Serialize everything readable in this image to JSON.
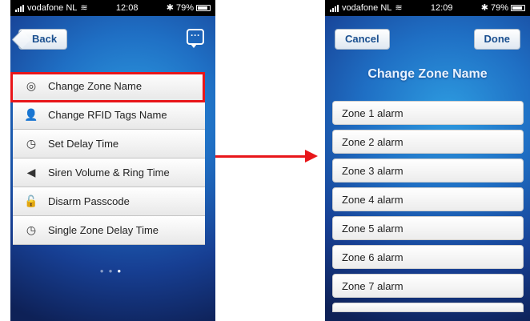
{
  "left_screen": {
    "status": {
      "carrier": "vodafone NL",
      "time": "12:08",
      "battery": "79%"
    },
    "back_label": "Back",
    "menu": [
      {
        "label": "Change Zone Name",
        "icon": "shield-icon"
      },
      {
        "label": "Change RFID Tags Name",
        "icon": "person-icon"
      },
      {
        "label": "Set Delay Time",
        "icon": "clock-icon"
      },
      {
        "label": "Siren Volume & Ring Time",
        "icon": "speaker-icon"
      },
      {
        "label": "Disarm Passcode",
        "icon": "padlock-icon"
      },
      {
        "label": "Single Zone Delay Time",
        "icon": "clock-icon"
      }
    ],
    "page_dots": {
      "count": 3,
      "active": 3
    }
  },
  "right_screen": {
    "status": {
      "carrier": "vodafone NL",
      "time": "12:09",
      "battery": "79%"
    },
    "cancel_label": "Cancel",
    "done_label": "Done",
    "title": "Change Zone Name",
    "zones": [
      "Zone 1 alarm",
      "Zone 2 alarm",
      "Zone 3 alarm",
      "Zone 4 alarm",
      "Zone 5 alarm",
      "Zone 6 alarm",
      "Zone 7 alarm"
    ]
  },
  "colors": {
    "highlight": "#e8161a",
    "arrow": "#e8161a",
    "nav_text": "#1a4f8f"
  }
}
